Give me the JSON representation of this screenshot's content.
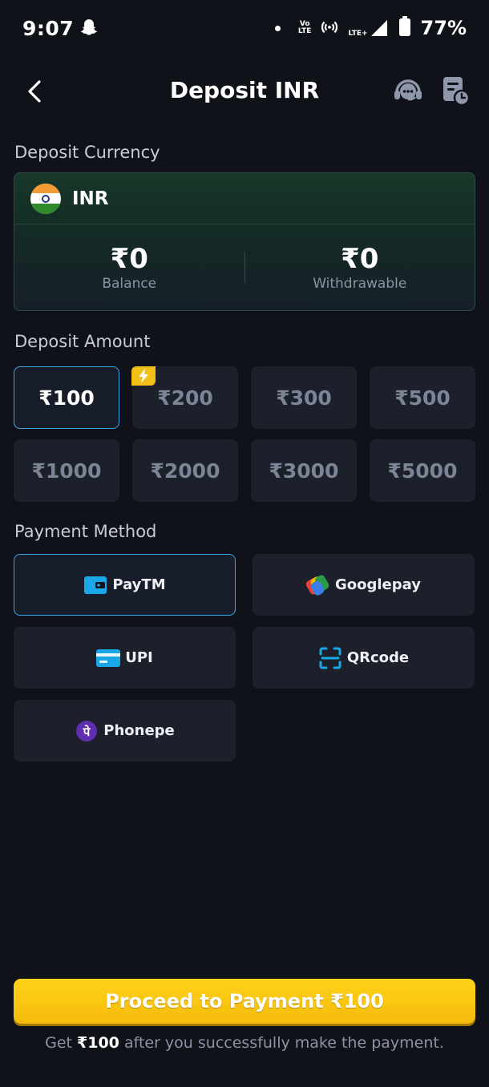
{
  "status_bar": {
    "time": "9:07",
    "volte_top": "Vo",
    "volte_bottom": "LTE",
    "network": "LTE+",
    "battery": "77%"
  },
  "header": {
    "title": "Deposit INR"
  },
  "deposit_currency": {
    "label": "Deposit Currency",
    "code": "INR",
    "balance_value": "₹0",
    "balance_label": "Balance",
    "withdrawable_value": "₹0",
    "withdrawable_label": "Withdrawable"
  },
  "deposit_amount": {
    "label": "Deposit Amount",
    "options": [
      "₹100",
      "₹200",
      "₹300",
      "₹500",
      "₹1000",
      "₹2000",
      "₹3000",
      "₹5000"
    ],
    "selected": "₹100"
  },
  "payment_method": {
    "label": "Payment Method",
    "options": [
      "PayTM",
      "Googlepay",
      "UPI",
      "QRcode",
      "Phonepe"
    ],
    "selected": "PayTM"
  },
  "phonepe_glyph": "पे",
  "proceed": {
    "label": "Proceed to Payment ₹100"
  },
  "hint": {
    "prefix": "Get ",
    "amount": "₹100",
    "suffix": " after you successfully make the payment."
  },
  "colors": {
    "background": "#0f1219",
    "accent_blue": "#39a4e8",
    "accent_yellow": "#f5bb0b",
    "card_green": "#173828"
  }
}
